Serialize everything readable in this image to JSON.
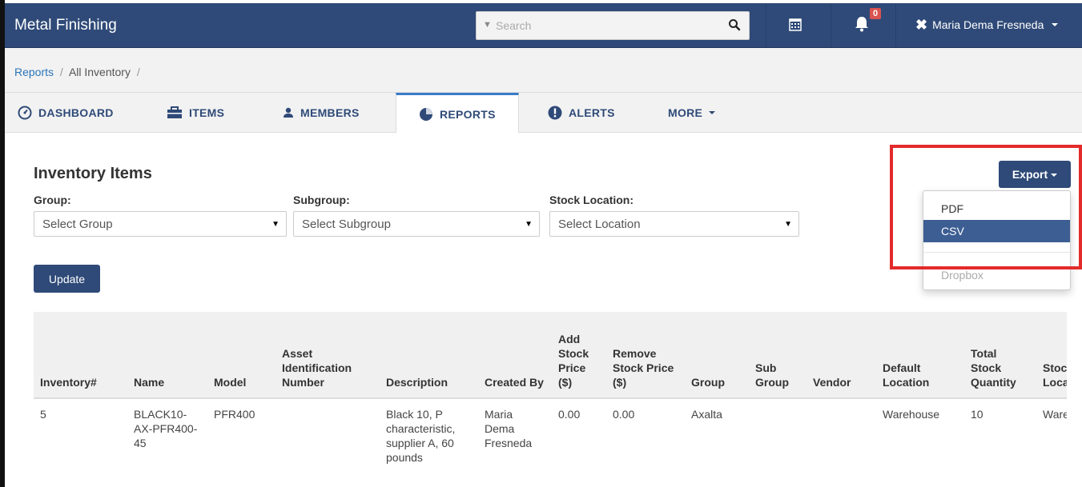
{
  "app": {
    "title": "Metal Finishing"
  },
  "search": {
    "placeholder": "Search"
  },
  "notifications": {
    "count": "0"
  },
  "user": {
    "name": "Maria Dema Fresneda"
  },
  "breadcrumb": {
    "root": "Reports",
    "current": "All Inventory",
    "sep": "/"
  },
  "tabs": [
    {
      "label": "DASHBOARD",
      "icon": "dashboard-icon"
    },
    {
      "label": "ITEMS",
      "icon": "briefcase-icon"
    },
    {
      "label": "MEMBERS",
      "icon": "user-icon"
    },
    {
      "label": "REPORTS",
      "icon": "pie-chart-icon",
      "active": true
    },
    {
      "label": "ALERTS",
      "icon": "exclamation-icon"
    },
    {
      "label": "MORE",
      "icon": "caret-down-icon"
    }
  ],
  "page": {
    "title": "Inventory Items"
  },
  "filters": {
    "group": {
      "label": "Group:",
      "value": "Select Group"
    },
    "subgroup": {
      "label": "Subgroup:",
      "value": "Select Subgroup"
    },
    "location": {
      "label": "Stock Location:",
      "value": "Select Location"
    }
  },
  "buttons": {
    "update": "Update",
    "export": "Export"
  },
  "export_menu": {
    "items": [
      "PDF",
      "CSV",
      "Dropbox"
    ],
    "active": "CSV"
  },
  "table": {
    "headers": [
      "Inventory#",
      "Name",
      "Model",
      "Asset Identification Number",
      "Description",
      "Created By",
      "Add Stock Price ($)",
      "Remove Stock Price ($)",
      "Group",
      "Sub Group",
      "Vendor",
      "Default Location",
      "Total Stock Quantity",
      "Stock Location"
    ],
    "rows": [
      [
        "5",
        "BLACK10-AX-PFR400-45",
        "PFR400",
        "",
        "Black 10, P characteristic, supplier A, 60 pounds",
        "Maria Dema Fresneda",
        "0.00",
        "0.00",
        "Axalta",
        "",
        "",
        "Warehouse",
        "10",
        "Warehouse"
      ]
    ]
  },
  "colors": {
    "navbar": "#2f4a78",
    "accent": "#3a7bc8",
    "highlight": "#e32b2b",
    "badge": "#d9534f"
  }
}
